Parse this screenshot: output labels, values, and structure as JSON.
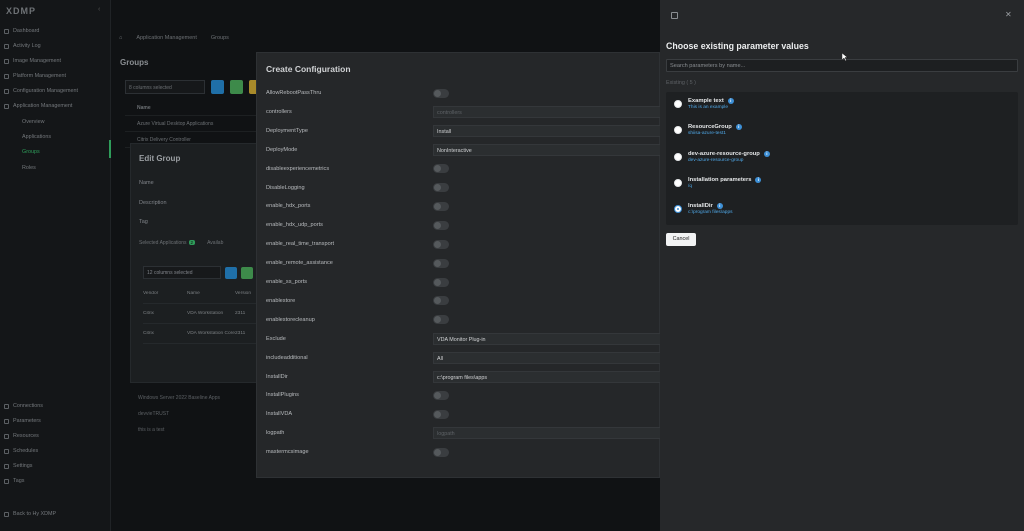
{
  "sidebar": {
    "logo": "XDMP",
    "top_items": [
      {
        "label": "Dashboard",
        "icon": "dashboard-icon"
      },
      {
        "label": "Activity Log",
        "icon": "activity-icon"
      },
      {
        "label": "Image Management",
        "icon": "image-icon"
      },
      {
        "label": "Platform Management",
        "icon": "platform-icon"
      },
      {
        "label": "Configuration Management",
        "icon": "config-icon"
      },
      {
        "label": "Application Management",
        "icon": "apps-icon"
      }
    ],
    "sub_items": [
      {
        "label": "Overview"
      },
      {
        "label": "Applications"
      },
      {
        "label": "Groups"
      },
      {
        "label": "Roles"
      }
    ],
    "bottom_items": [
      {
        "label": "Connections",
        "icon": "connections-icon"
      },
      {
        "label": "Parameters",
        "icon": "parameters-icon"
      },
      {
        "label": "Resources",
        "icon": "resources-icon"
      },
      {
        "label": "Schedules",
        "icon": "schedules-icon"
      },
      {
        "label": "Settings",
        "icon": "settings-icon"
      },
      {
        "label": "Tags",
        "icon": "tags-icon"
      }
    ],
    "footer": "Back to Hy XDMP"
  },
  "main": {
    "crumbs": [
      "Application Management",
      "Groups"
    ],
    "title": "Groups",
    "columns_selected": "8 columns selected",
    "table": {
      "header": "Name",
      "rows": [
        "Azure Virtual Desktop Applications",
        "Citrix Delivery Controller"
      ]
    },
    "list": [
      "Windows Server 2022 Baseline Apps",
      "devvieTRUST",
      "this is a test"
    ]
  },
  "edit_group": {
    "title": "Edit Group",
    "labels": [
      "Name",
      "Description",
      "Tag"
    ],
    "tabs": [
      "Selected Applications",
      "Availab"
    ],
    "badge": "2",
    "columns_selected": "12 columns selected",
    "headers": [
      "Vendor",
      "Name",
      "Version"
    ],
    "rows": [
      [
        "Citrix",
        "VDA Workstation",
        "2311"
      ],
      [
        "Citrix",
        "VDA Workstation Core",
        "2311"
      ]
    ]
  },
  "config": {
    "title": "Create Configuration",
    "fields": [
      {
        "label": "AllowRebootPassThru",
        "type": "toggle"
      },
      {
        "label": "controllers",
        "type": "input",
        "value": "controllers",
        "placeholder": true
      },
      {
        "label": "DeploymentType",
        "type": "input",
        "value": "Install"
      },
      {
        "label": "DeployMode",
        "type": "input",
        "value": "NonInteractive"
      },
      {
        "label": "disableexperiencemetrics",
        "type": "toggle"
      },
      {
        "label": "DisableLogging",
        "type": "toggle"
      },
      {
        "label": "enable_hdx_ports",
        "type": "toggle"
      },
      {
        "label": "enable_hdx_udp_ports",
        "type": "toggle"
      },
      {
        "label": "enable_real_time_transport",
        "type": "toggle"
      },
      {
        "label": "enable_remote_assistance",
        "type": "toggle"
      },
      {
        "label": "enable_ss_ports",
        "type": "toggle"
      },
      {
        "label": "enablestore",
        "type": "toggle"
      },
      {
        "label": "enablestorecleanup",
        "type": "toggle"
      },
      {
        "label": "Exclude",
        "type": "input",
        "value": "VDA Monitor Plug-in"
      },
      {
        "label": "includeadditional",
        "type": "input",
        "value": "All"
      },
      {
        "label": "InstallDir",
        "type": "input",
        "value": "c:\\program files\\apps"
      },
      {
        "label": "InstallPlugins",
        "type": "toggle"
      },
      {
        "label": "InstallVDA",
        "type": "toggle"
      },
      {
        "label": "logpath",
        "type": "input",
        "value": "logpath",
        "placeholder": true
      },
      {
        "label": "mastermcsimage",
        "type": "toggle"
      }
    ]
  },
  "drawer": {
    "title": "Choose existing parameter values",
    "search_placeholder": "Search parameters by name...",
    "count": "Existing ( 5 )",
    "options": [
      {
        "name": "Example text",
        "value": "This is an example",
        "selected": false
      },
      {
        "name": "ResourceGroup",
        "value": "shiisa-azure-test1",
        "selected": false
      },
      {
        "name": "dev-azure-resource-group",
        "value": "dev-azure-resource-group",
        "selected": false
      },
      {
        "name": "Installation parameters",
        "value": "/q",
        "selected": false
      },
      {
        "name": "InstallDir",
        "value": "c:\\program files\\apps",
        "selected": true
      }
    ],
    "cancel": "Cancel",
    "info_glyph": "i",
    "close_glyph": "✕"
  }
}
